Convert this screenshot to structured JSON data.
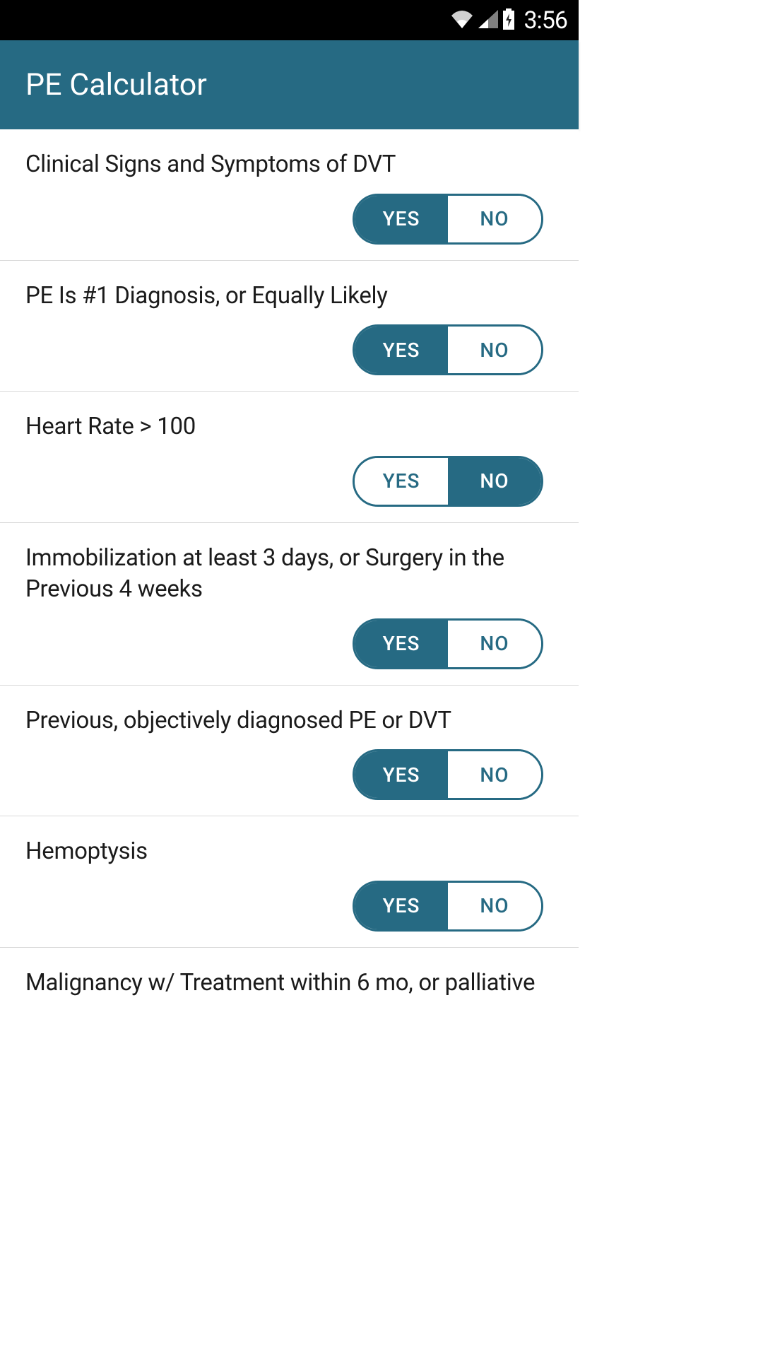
{
  "status": {
    "time": "3:56"
  },
  "header": {
    "title": "PE Calculator"
  },
  "toggle": {
    "yes": "YES",
    "no": "NO"
  },
  "items": [
    {
      "label": "Clinical Signs and Symptoms of DVT",
      "selected": "yes"
    },
    {
      "label": "PE Is #1 Diagnosis, or Equally Likely",
      "selected": "yes"
    },
    {
      "label": "Heart Rate > 100",
      "selected": "no"
    },
    {
      "label": "Immobilization at least 3 days, or Surgery in the Previous 4 weeks",
      "selected": "yes"
    },
    {
      "label": "Previous, objectively diagnosed PE or DVT",
      "selected": "yes"
    },
    {
      "label": "Hemoptysis",
      "selected": "yes"
    },
    {
      "label": "Malignancy w/ Treatment within 6 mo, or palliative",
      "selected": ""
    }
  ]
}
